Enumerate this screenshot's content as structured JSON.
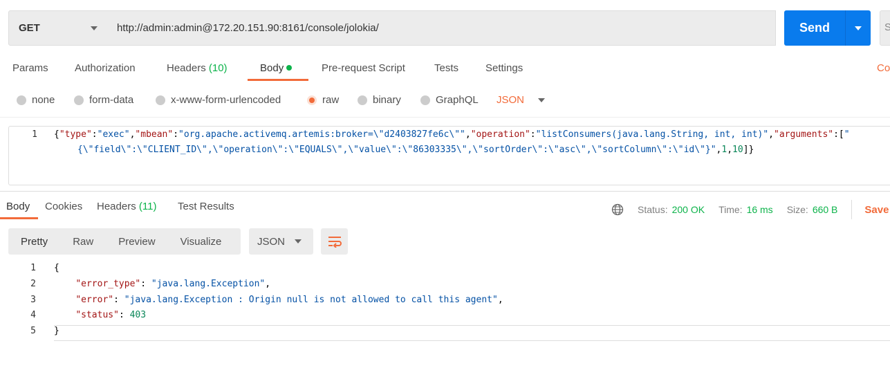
{
  "request": {
    "method": "GET",
    "url": "http://admin:admin@172.20.151.90:8161/console/jolokia/",
    "send_label": "Send",
    "save_label": "S"
  },
  "req_tabs": [
    {
      "label": "Params"
    },
    {
      "label": "Authorization"
    },
    {
      "label": "Headers",
      "count": "(10)"
    },
    {
      "label": "Body"
    },
    {
      "label": "Pre-request Script"
    },
    {
      "label": "Tests"
    },
    {
      "label": "Settings"
    }
  ],
  "cookies_link": "Co",
  "body_types": [
    "none",
    "form-data",
    "x-www-form-urlencoded",
    "raw",
    "binary",
    "GraphQL"
  ],
  "body_format": "JSON",
  "request_body": {
    "line_number": "1",
    "lines": [
      [
        [
          "{",
          "p"
        ],
        [
          "\"type\"",
          "k"
        ],
        [
          ":",
          "p"
        ],
        [
          "\"exec\"",
          "s"
        ],
        [
          ",",
          "p"
        ],
        [
          "\"mbean\"",
          "k"
        ],
        [
          ":",
          "p"
        ],
        [
          "\"org.apache.activemq.artemis:broker=\\\"d2403827fe6c\\\"\"",
          "s"
        ],
        [
          ",",
          "p"
        ],
        [
          "\"operation\"",
          "k"
        ],
        [
          ":",
          "p"
        ],
        [
          "\"listConsumers(java.lang.String, int, int)\"",
          "s"
        ],
        [
          ",",
          "p"
        ],
        [
          "\"arguments\"",
          "k"
        ],
        [
          ":[",
          "p"
        ],
        [
          "\"",
          "s"
        ]
      ],
      [
        [
          "{\\\"field\\\":\\\"CLIENT_ID\\\",\\\"operation\\\":\\\"EQUALS\\\",\\\"value\\\":\\\"86303335\\\",\\\"sortOrder\\\":\\\"asc\\\",\\\"sortColumn\\\":\\\"id\\\"}\"",
          "s"
        ],
        [
          ",",
          "p"
        ],
        [
          "1",
          "n"
        ],
        [
          ",",
          "p"
        ],
        [
          "10",
          "n"
        ],
        [
          "]}",
          "p"
        ]
      ]
    ]
  },
  "resp_tabs": [
    {
      "label": "Body"
    },
    {
      "label": "Cookies"
    },
    {
      "label": "Headers",
      "count": "(11)"
    },
    {
      "label": "Test Results"
    }
  ],
  "status": {
    "status_label": "Status:",
    "status_value": "200 OK",
    "time_label": "Time:",
    "time_value": "16 ms",
    "size_label": "Size:",
    "size_value": "660 B",
    "save_response": "Save R"
  },
  "view_modes": [
    "Pretty",
    "Raw",
    "Preview",
    "Visualize"
  ],
  "resp_format": "JSON",
  "response_body": [
    {
      "n": "1",
      "t": [
        [
          "{",
          "p"
        ]
      ]
    },
    {
      "n": "2",
      "t": [
        [
          "    ",
          "p"
        ],
        [
          "\"error_type\"",
          "k"
        ],
        [
          ": ",
          "p"
        ],
        [
          "\"java.lang.Exception\"",
          "s"
        ],
        [
          ",",
          "p"
        ]
      ]
    },
    {
      "n": "3",
      "t": [
        [
          "    ",
          "p"
        ],
        [
          "\"error\"",
          "k"
        ],
        [
          ": ",
          "p"
        ],
        [
          "\"java.lang.Exception : Origin null is not allowed to call this agent\"",
          "s"
        ],
        [
          ",",
          "p"
        ]
      ]
    },
    {
      "n": "4",
      "t": [
        [
          "    ",
          "p"
        ],
        [
          "\"status\"",
          "k"
        ],
        [
          ": ",
          "p"
        ],
        [
          "403",
          "n"
        ]
      ]
    },
    {
      "n": "5",
      "t": [
        [
          "}",
          "p"
        ]
      ]
    }
  ],
  "colors": {
    "accent": "#f26b3a",
    "send": "#097bed",
    "success": "#0cb34a"
  }
}
